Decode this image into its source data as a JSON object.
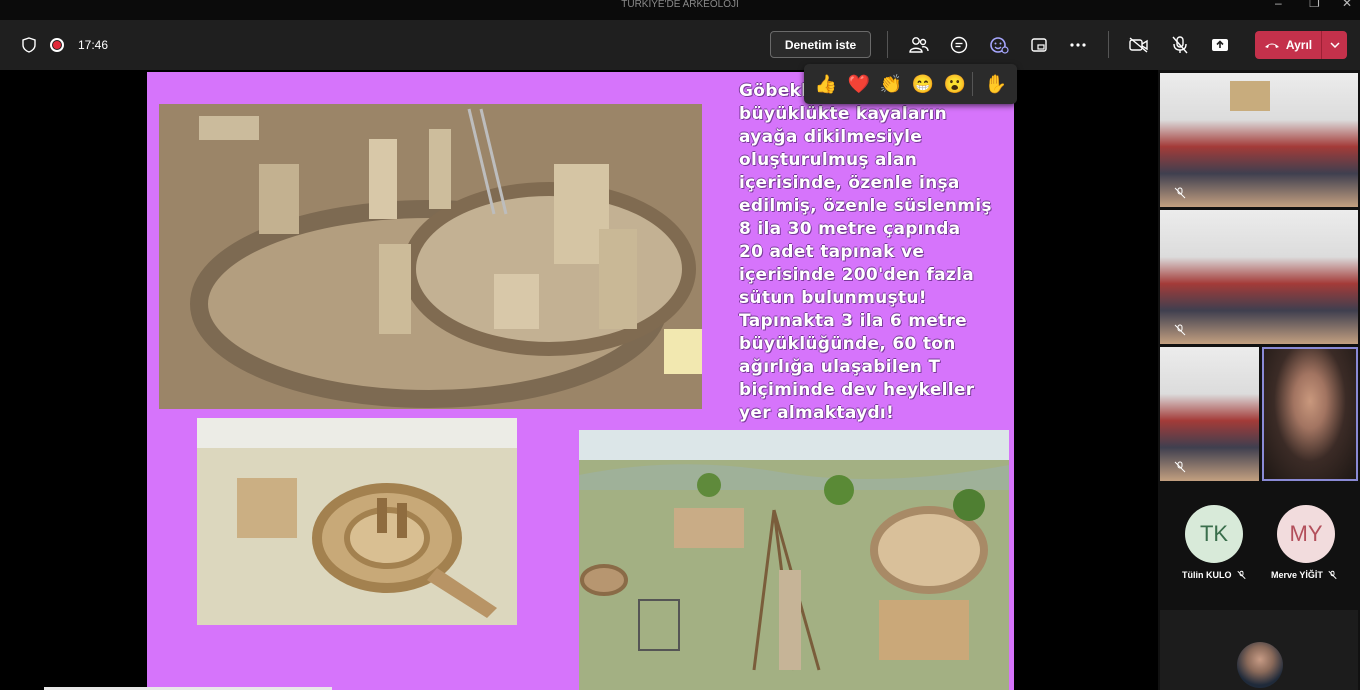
{
  "window": {
    "title": "TÜRKİYE'DE ARKEOLOJİ"
  },
  "toolbar": {
    "time": "17:46",
    "request_control_label": "Denetim iste",
    "leave_label": "Ayrıl",
    "icons": [
      "shield-icon",
      "record-icon",
      "people-icon",
      "chat-icon",
      "reactions-icon",
      "share-tray-icon",
      "more-icon",
      "camera-off-icon",
      "mic-off-icon",
      "share-icon",
      "phone-icon",
      "chevron-down-icon"
    ]
  },
  "reactions": {
    "items": [
      {
        "name": "like",
        "glyph": "👍"
      },
      {
        "name": "heart",
        "glyph": "❤️"
      },
      {
        "name": "applause",
        "glyph": "👏"
      },
      {
        "name": "laugh",
        "glyph": "😁"
      },
      {
        "name": "surprised",
        "glyph": "😮"
      },
      {
        "name": "raise-hand",
        "glyph": "✋"
      }
    ]
  },
  "slide": {
    "background": "#d674fb",
    "text_lines": [
      "Göbekli",
      "büyüklükte kayaların",
      "ayağa dikilmesiyle",
      "oluşturulmuş alan",
      "içerisinde, özenle inşa",
      "edilmiş, özenle süslenmiş",
      "8 ila 30 metre çapında",
      "20 adet tapınak ve",
      "içerisinde 200'den fazla",
      "sütun bulunmuştu!",
      "Tapınakta 3 ila 6 metre",
      "büyüklüğünde, 60 ton",
      "ağırlığa ulaşabilen T",
      "biçiminde dev heykeller",
      "yer almaktaydı!"
    ]
  },
  "participants": [
    {
      "initials": "TK",
      "name": "Tülin KULO",
      "muted": true
    },
    {
      "initials": "MY",
      "name": "Merve YİĞİT",
      "muted": true
    }
  ],
  "colors": {
    "leave": "#c4314b",
    "toolbar": "#1f1f1f",
    "slide": "#d674fb"
  }
}
